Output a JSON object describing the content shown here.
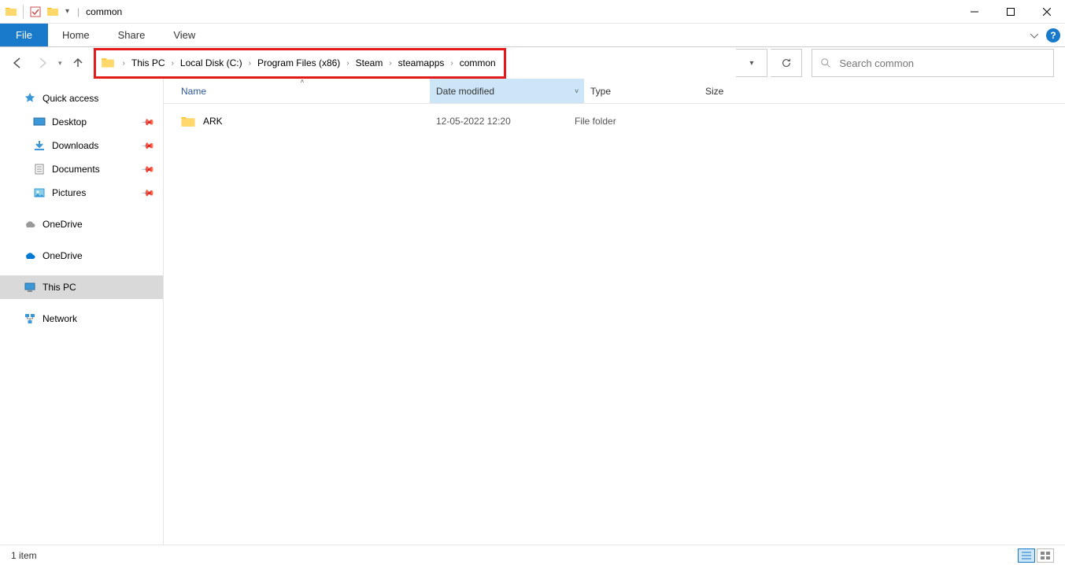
{
  "title": "common",
  "ribbon": {
    "file": "File",
    "tabs": [
      "Home",
      "Share",
      "View"
    ]
  },
  "breadcrumb": [
    "This PC",
    "Local Disk (C:)",
    "Program Files (x86)",
    "Steam",
    "steamapps",
    "common"
  ],
  "search": {
    "placeholder": "Search common"
  },
  "sidebar": {
    "quick_access": "Quick access",
    "quick_items": [
      {
        "label": "Desktop",
        "pinned": true
      },
      {
        "label": "Downloads",
        "pinned": true
      },
      {
        "label": "Documents",
        "pinned": true
      },
      {
        "label": "Pictures",
        "pinned": true
      }
    ],
    "onedrive1": "OneDrive",
    "onedrive2": "OneDrive",
    "this_pc": "This PC",
    "network": "Network"
  },
  "columns": {
    "name": "Name",
    "date": "Date modified",
    "type": "Type",
    "size": "Size"
  },
  "rows": [
    {
      "name": "ARK",
      "date": "12-05-2022 12:20",
      "type": "File folder",
      "size": ""
    }
  ],
  "status": "1 item"
}
